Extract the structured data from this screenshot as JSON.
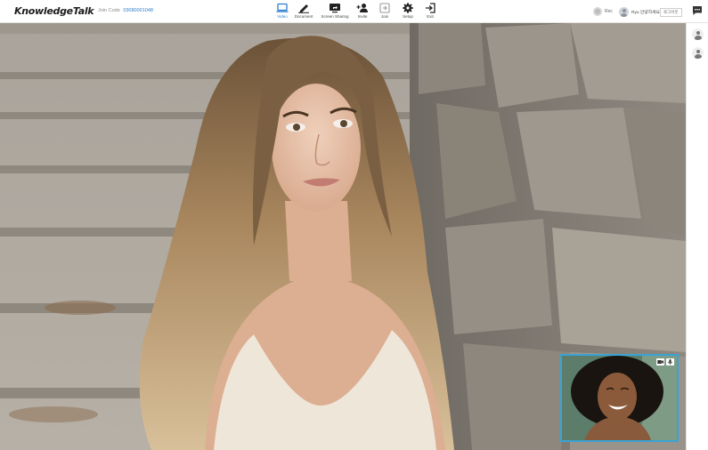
{
  "app": {
    "logo": "KnowledgeTalk",
    "room_label": "Join Code",
    "room_code": "03080001048"
  },
  "toolbar": {
    "items": [
      {
        "label": "Video",
        "icon": "laptop-icon",
        "active": true
      },
      {
        "label": "Document",
        "icon": "pen-icon"
      },
      {
        "label": "Screen Sharing",
        "icon": "screen-share-icon"
      },
      {
        "label": "Invite",
        "icon": "add-user-icon"
      },
      {
        "label": "Join",
        "icon": "join-icon"
      },
      {
        "label": "Setup",
        "icon": "gear-icon"
      },
      {
        "label": "Exit",
        "icon": "exit-icon"
      }
    ]
  },
  "header_right": {
    "rec_label": "Rec",
    "user_name": "Ryu 안녕하세요",
    "logout_label": "로그아웃",
    "chat_icon": "chat-icon"
  },
  "participants": {
    "rail_icons": [
      "user-icon",
      "user-icon"
    ]
  },
  "self_view": {
    "icons": [
      "camera-icon",
      "microphone-icon"
    ]
  },
  "colors": {
    "accent": "#2f7ecf",
    "pip_border": "#3aa3d4",
    "topbar_bg": "#ffffff"
  }
}
